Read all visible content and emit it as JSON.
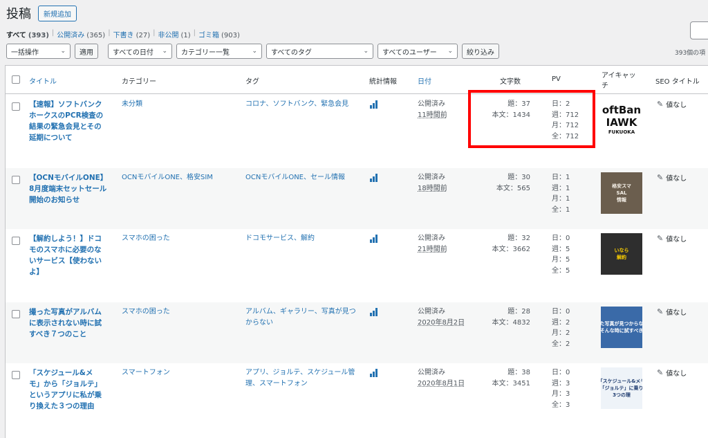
{
  "header": {
    "title": "投稿",
    "add_new": "新規追加"
  },
  "status_filters": [
    {
      "label": "すべて",
      "count": "(393)",
      "current": true
    },
    {
      "label": "公開済み",
      "count": "(365)"
    },
    {
      "label": "下書き",
      "count": "(27)"
    },
    {
      "label": "非公開",
      "count": "(1)"
    },
    {
      "label": "ゴミ箱",
      "count": "(903)"
    }
  ],
  "toolbar": {
    "bulk_action": "一括操作",
    "apply": "適用",
    "date_filter": "すべての日付",
    "category_filter": "カテゴリー一覧",
    "tag_filter": "すべてのタグ",
    "user_filter": "すべてのユーザー",
    "filter_button": "絞り込み",
    "item_count": "393個の項"
  },
  "columns": {
    "title": "タイトル",
    "category": "カテゴリー",
    "tags": "タグ",
    "stats": "統計情報",
    "date": "日付",
    "word_count": "文字数",
    "pv": "PV",
    "eyecatch_line1": "アイキャッ",
    "eyecatch_line2": "チ",
    "seo": "SEO タイトル"
  },
  "rows": [
    {
      "title_lines": [
        "【速報】ソフトバンク",
        "ホークスのPCR検査の",
        "結果の緊急会見とその",
        "延期について"
      ],
      "category_lines": [
        "未分類"
      ],
      "tag_lines": [
        "コロナ、ソフトバンク、緊急会見"
      ],
      "status": "公開済み",
      "time": "11時間前",
      "wc_title": "題：37",
      "wc_body": "本文：1434",
      "pv": [
        "日：2",
        "週：712",
        "月：712",
        "全：712"
      ],
      "thumb_text": [
        "oftBan",
        "IAWK",
        "FUKUOKA"
      ],
      "seo": "値なし"
    },
    {
      "title_lines": [
        "【OCNモバイルONE】",
        "8月度端末セットセール",
        "開始のお知らせ"
      ],
      "category_lines": [
        "OCNモバイルONE、格安SIM"
      ],
      "tag_lines": [
        "OCNモバイルONE、セール情報"
      ],
      "status": "公開済み",
      "time": "18時間前",
      "wc_title": "題：30",
      "wc_body": "本文：565",
      "pv": [
        "日：1",
        "週：1",
        "月：1",
        "全：1"
      ],
      "thumb_text": [
        "格安スマ",
        "SAL",
        "情報"
      ],
      "seo": "値なし"
    },
    {
      "title_lines": [
        "【解約しよう！】ドコ",
        "モのスマホに必要のな",
        "いサービス【使わない",
        "よ】"
      ],
      "category_lines": [
        "スマホの困った"
      ],
      "tag_lines": [
        "ドコモサービス、解約"
      ],
      "status": "公開済み",
      "time": "21時間前",
      "wc_title": "題：32",
      "wc_body": "本文：3662",
      "pv": [
        "日：0",
        "週：5",
        "月：5",
        "全：5"
      ],
      "thumb_text": [
        "いなら",
        "解約"
      ],
      "seo": "値なし"
    },
    {
      "title_lines": [
        "撮った写真がアルバム",
        "に表示されない時に試",
        "すべき７つのこと"
      ],
      "category_lines": [
        "スマホの困った"
      ],
      "tag_lines": [
        "アルバム、ギャラリー、写真が見つ",
        "からない"
      ],
      "status": "公開済み",
      "time": "2020年8月2日",
      "wc_title": "題：28",
      "wc_body": "本文：4832",
      "pv": [
        "日：0",
        "週：2",
        "月：2",
        "全：2"
      ],
      "thumb_text": [
        "った写真が見つからない",
        "そんな時に試すべき"
      ],
      "seo": "値なし"
    },
    {
      "title_lines": [
        "「スケジュール&メ",
        "モ」から「ジョルテ」",
        "というアプリに私が乗",
        "り換えた３つの理由"
      ],
      "category_lines": [
        "スマートフォン"
      ],
      "tag_lines": [
        "アプリ、ジョルテ、スケジュール管",
        "理、スマートフォン"
      ],
      "status": "公開済み",
      "time": "2020年8月1日",
      "wc_title": "題：38",
      "wc_body": "本文：3451",
      "pv": [
        "日：0",
        "週：3",
        "月：3",
        "全：3"
      ],
      "thumb_text": [
        "「スケジュール&メモ",
        "「ジョルテ」に乗り",
        "3つの理"
      ],
      "seo": "値なし"
    }
  ]
}
